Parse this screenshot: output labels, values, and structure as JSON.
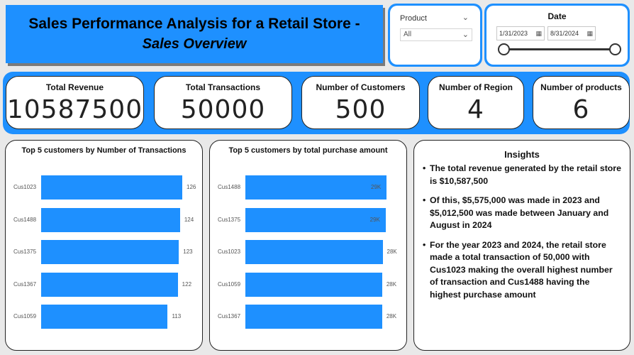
{
  "title": {
    "line1": "Sales Performance Analysis for a Retail Store -",
    "line2": "Sales Overview"
  },
  "product_slicer": {
    "label": "Product",
    "selected": "All"
  },
  "date_slicer": {
    "label": "Date",
    "start": "1/31/2023",
    "end": "8/31/2024"
  },
  "kpis": [
    {
      "label": "Total Revenue",
      "value": "10587500"
    },
    {
      "label": "Total Transactions",
      "value": "50000"
    },
    {
      "label": "Number of Customers",
      "value": "500"
    },
    {
      "label": "Number of Region",
      "value": "4"
    },
    {
      "label": "Number of products",
      "value": "6"
    }
  ],
  "chart_data": [
    {
      "type": "bar",
      "orientation": "horizontal",
      "title": "Top 5 customers by Number of Transactions",
      "categories": [
        "Cus1023",
        "Cus1488",
        "Cus1375",
        "Cus1367",
        "Cus1059"
      ],
      "values": [
        126,
        124,
        123,
        122,
        113
      ],
      "labels": [
        "126",
        "124",
        "123",
        "122",
        "113"
      ],
      "label_position": "outside",
      "color": "#1e90ff"
    },
    {
      "type": "bar",
      "orientation": "horizontal",
      "title": "Top 5 customers by total purchase amount",
      "categories": [
        "Cus1488",
        "Cus1375",
        "Cus1023",
        "Cus1059",
        "Cus1367"
      ],
      "values": [
        29000,
        28800,
        28200,
        28100,
        28100
      ],
      "labels": [
        "29K",
        "29K",
        "28K",
        "28K",
        "28K"
      ],
      "label_position": "end",
      "color": "#1e90ff"
    }
  ],
  "insights": {
    "title": "Insights",
    "items": [
      "The total revenue generated by the retail store is $10,587,500",
      "Of this,  $5,575,000 was made in 2023 and $5,012,500 was made between January and August  in 2024",
      "For the year 2023 and 2024, the retail store made a total transaction of 50,000 with Cus1023 making the overall highest number of transaction and Cus1488 having the highest purchase amount"
    ]
  },
  "colors": {
    "accent": "#1e90ff",
    "background": "#e9e9e9"
  }
}
